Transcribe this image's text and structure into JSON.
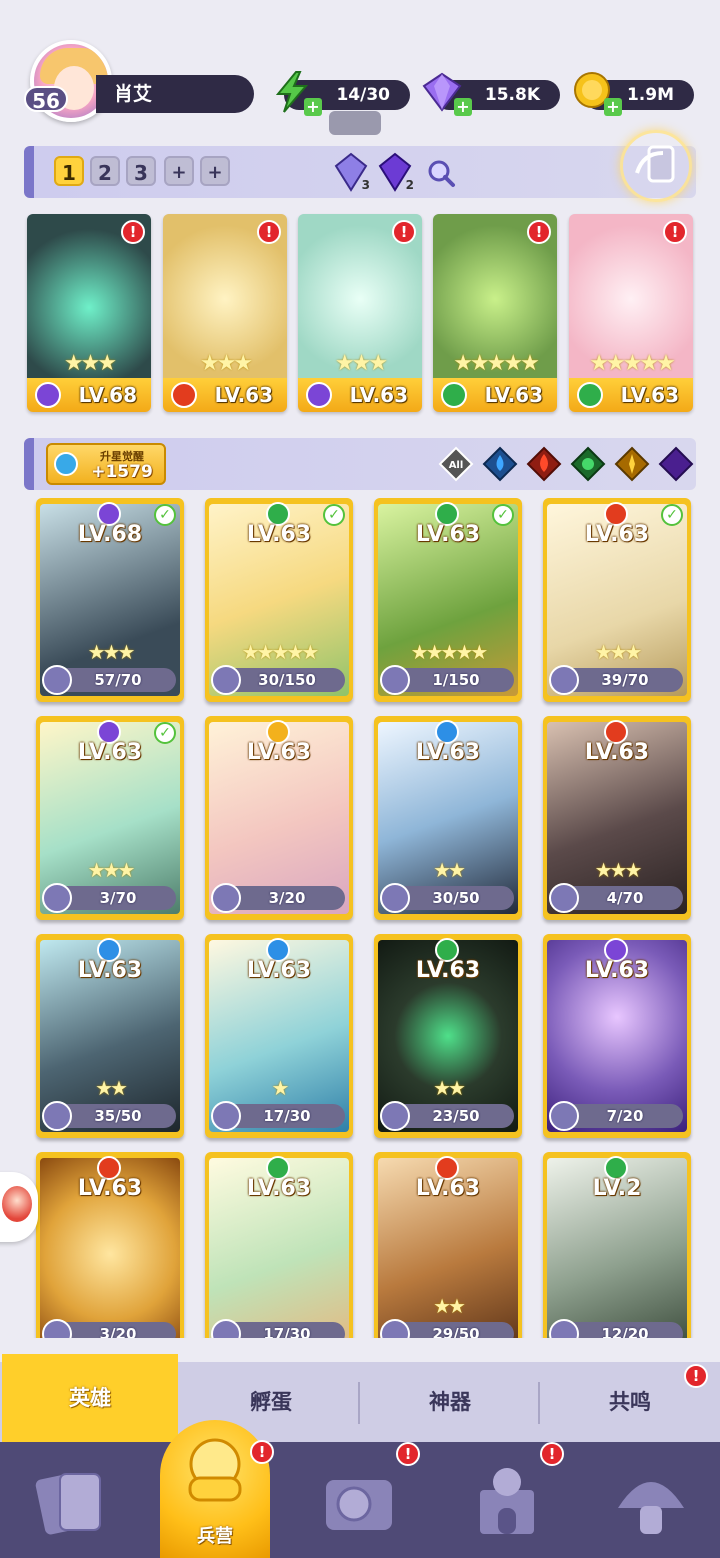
{
  "player": {
    "name": "肖艾",
    "level": "56"
  },
  "resources": [
    {
      "name": "energy-icon",
      "value": "14/30",
      "color": "#55c848"
    },
    {
      "name": "gem-icon",
      "value": "15.8K",
      "color": "#8a5ee0"
    },
    {
      "name": "coin-icon",
      "value": "1.9M",
      "color": "#f5b800"
    }
  ],
  "team_tabs": [
    "1",
    "2",
    "3",
    "+",
    "+"
  ],
  "team_crystals": [
    {
      "name": "crystal-blue-icon",
      "count": "3"
    },
    {
      "name": "crystal-purple-icon",
      "count": "2"
    }
  ],
  "team_heroes": [
    {
      "level": "LV.68",
      "element": "dark",
      "stars": "★★★",
      "art": "#2e4a4a"
    },
    {
      "level": "LV.63",
      "element": "fire",
      "stars": "★★★",
      "art": "#e2c06a"
    },
    {
      "level": "LV.63",
      "element": "dark",
      "stars": "★★★",
      "art": "#9fd8c5"
    },
    {
      "level": "LV.63",
      "element": "nature",
      "stars": "★★★★★",
      "art": "#6f9d4a"
    },
    {
      "level": "LV.63",
      "element": "nature",
      "stars": "★★★★★",
      "art": "#f4b6c6"
    }
  ],
  "awaken": {
    "label": "升星觉醒",
    "value": "+1579"
  },
  "filters": [
    "All",
    "water",
    "fire",
    "nature",
    "light",
    "dark"
  ],
  "heroes": [
    {
      "level": "LV.68",
      "element": "dark",
      "checked": true,
      "shards": "57/70",
      "stars": "★★★",
      "art": "#3a4b58"
    },
    {
      "level": "LV.63",
      "element": "nature",
      "checked": true,
      "shards": "30/150",
      "stars": "★★★★★",
      "art": "#f6d980"
    },
    {
      "level": "LV.63",
      "element": "nature",
      "checked": true,
      "shards": "1/150",
      "stars": "★★★★★",
      "art": "#6ea23e"
    },
    {
      "level": "LV.63",
      "element": "fire",
      "checked": true,
      "shards": "39/70",
      "stars": "★★★",
      "art": "#e8d7a8"
    },
    {
      "level": "LV.63",
      "element": "dark",
      "checked": true,
      "shards": "3/70",
      "stars": "★★★",
      "art": "#a6e0c8"
    },
    {
      "level": "LV.63",
      "element": "light",
      "checked": false,
      "shards": "3/20",
      "stars": "",
      "art": "#f3c6c0"
    },
    {
      "level": "LV.63",
      "element": "water",
      "checked": false,
      "shards": "30/50",
      "stars": "★★",
      "art": "#8fb6d8"
    },
    {
      "level": "LV.63",
      "element": "fire",
      "checked": false,
      "shards": "4/70",
      "stars": "★★★",
      "art": "#5b4a4a"
    },
    {
      "level": "LV.63",
      "element": "water",
      "checked": false,
      "shards": "35/50",
      "stars": "★★",
      "art": "#4d6572"
    },
    {
      "level": "LV.63",
      "element": "water",
      "checked": false,
      "shards": "17/30",
      "stars": "★",
      "art": "#8fd2d8"
    },
    {
      "level": "LV.63",
      "element": "nature",
      "checked": false,
      "shards": "23/50",
      "stars": "★★",
      "art": "#2b3b2c"
    },
    {
      "level": "LV.63",
      "element": "dark",
      "checked": false,
      "shards": "7/20",
      "stars": "",
      "art": "#7a5bb8"
    },
    {
      "level": "LV.63",
      "element": "fire",
      "checked": false,
      "shards": "3/20",
      "stars": "",
      "art": "#e0a33a"
    },
    {
      "level": "LV.63",
      "element": "nature",
      "checked": false,
      "shards": "17/30",
      "stars": "",
      "art": "#bfe3b8"
    },
    {
      "level": "LV.63",
      "element": "fire",
      "checked": false,
      "shards": "29/50",
      "stars": "★★",
      "art": "#b97a3e"
    },
    {
      "level": "LV.2",
      "element": "nature",
      "checked": false,
      "shards": "12/20",
      "stars": "",
      "art": "#8ea08e"
    }
  ],
  "sub_tabs": [
    "英雄",
    "孵蛋",
    "神器",
    "共鸣"
  ],
  "bottom_nav": {
    "active_label": "兵营"
  },
  "element_colors": {
    "dark": "#7b45d6",
    "fire": "#e23c1e",
    "nature": "#2fae4a",
    "water": "#2d8fe6",
    "light": "#f3b11c"
  }
}
